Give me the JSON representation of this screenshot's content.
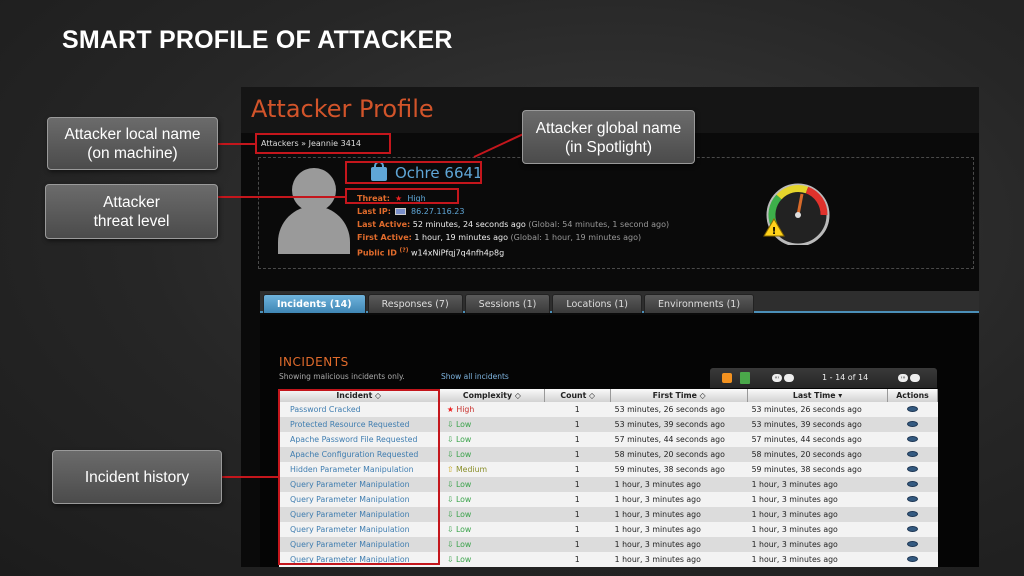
{
  "slide": {
    "title": "SMART PROFILE OF ATTACKER"
  },
  "profile": {
    "title": "Attacker Profile",
    "breadcrumb": "Attackers » Jeannie 3414",
    "global_name": "Ochre 6641",
    "threat_label": "Threat:",
    "threat_value": "High",
    "last_ip_label": "Last IP:",
    "last_ip_value": "86.27.116.23",
    "last_active_label": "Last Active:",
    "last_active_value": "52 minutes, 24 seconds ago",
    "last_active_global": "(Global: 54 minutes, 1 second ago)",
    "first_active_label": "First Active:",
    "first_active_value": "1 hour, 19 minutes ago",
    "first_active_global": "(Global: 1 hour, 19 minutes ago)",
    "public_id_label": "Public ID",
    "public_id_hint": "(?)",
    "public_id_value": "w14xNiPfqj7q4nfh4p8g",
    "threat_gauge_icon": "speedometer-warning-icon",
    "threat_gauge_level": 0.8
  },
  "tabs": [
    {
      "label": "Incidents (14)"
    },
    {
      "label": "Responses (7)"
    },
    {
      "label": "Sessions (1)"
    },
    {
      "label": "Locations (1)"
    },
    {
      "label": "Environments (1)"
    }
  ],
  "incidents": {
    "title": "INCIDENTS",
    "subtitle": "Showing malicious incidents only.",
    "show_all": "Show all incidents",
    "page_range": "1 - 14 of 14",
    "prev_label": "«‹",
    "next_label": "›»",
    "columns": [
      "Incident ◇",
      "Complexity ◇",
      "Count ◇",
      "First Time ◇",
      "Last Time ▾",
      "Actions"
    ],
    "rows": [
      {
        "incident": "Password Cracked",
        "complexity": "High",
        "count": "1",
        "first": "53 minutes, 26 seconds ago",
        "last": "53 minutes, 26 seconds ago"
      },
      {
        "incident": "Protected Resource Requested",
        "complexity": "Low",
        "count": "1",
        "first": "53 minutes, 39 seconds ago",
        "last": "53 minutes, 39 seconds ago"
      },
      {
        "incident": "Apache Password File Requested",
        "complexity": "Low",
        "count": "1",
        "first": "57 minutes, 44 seconds ago",
        "last": "57 minutes, 44 seconds ago"
      },
      {
        "incident": "Apache Configuration Requested",
        "complexity": "Low",
        "count": "1",
        "first": "58 minutes, 20 seconds ago",
        "last": "58 minutes, 20 seconds ago"
      },
      {
        "incident": "Hidden Parameter Manipulation",
        "complexity": "Medium",
        "count": "1",
        "first": "59 minutes, 38 seconds ago",
        "last": "59 minutes, 38 seconds ago"
      },
      {
        "incident": "Query Parameter Manipulation",
        "complexity": "Low",
        "count": "1",
        "first": "1 hour, 3 minutes ago",
        "last": "1 hour, 3 minutes ago"
      },
      {
        "incident": "Query Parameter Manipulation",
        "complexity": "Low",
        "count": "1",
        "first": "1 hour, 3 minutes ago",
        "last": "1 hour, 3 minutes ago"
      },
      {
        "incident": "Query Parameter Manipulation",
        "complexity": "Low",
        "count": "1",
        "first": "1 hour, 3 minutes ago",
        "last": "1 hour, 3 minutes ago"
      },
      {
        "incident": "Query Parameter Manipulation",
        "complexity": "Low",
        "count": "1",
        "first": "1 hour, 3 minutes ago",
        "last": "1 hour, 3 minutes ago"
      },
      {
        "incident": "Query Parameter Manipulation",
        "complexity": "Low",
        "count": "1",
        "first": "1 hour, 3 minutes ago",
        "last": "1 hour, 3 minutes ago"
      },
      {
        "incident": "Query Parameter Manipulation",
        "complexity": "Low",
        "count": "1",
        "first": "1 hour, 3 minutes ago",
        "last": "1 hour, 3 minutes ago"
      }
    ]
  },
  "callouts": {
    "local_name": "Attacker local name\n(on machine)",
    "global_name": "Attacker global name\n(in Spotlight)",
    "threat_level": "Attacker\nthreat level",
    "history": "Incident history"
  },
  "colors": {
    "highlight": "#c4161c",
    "accent_orange": "#e06b2c",
    "link_blue": "#5fa6d6",
    "tab_active": "#4b8fb8"
  }
}
